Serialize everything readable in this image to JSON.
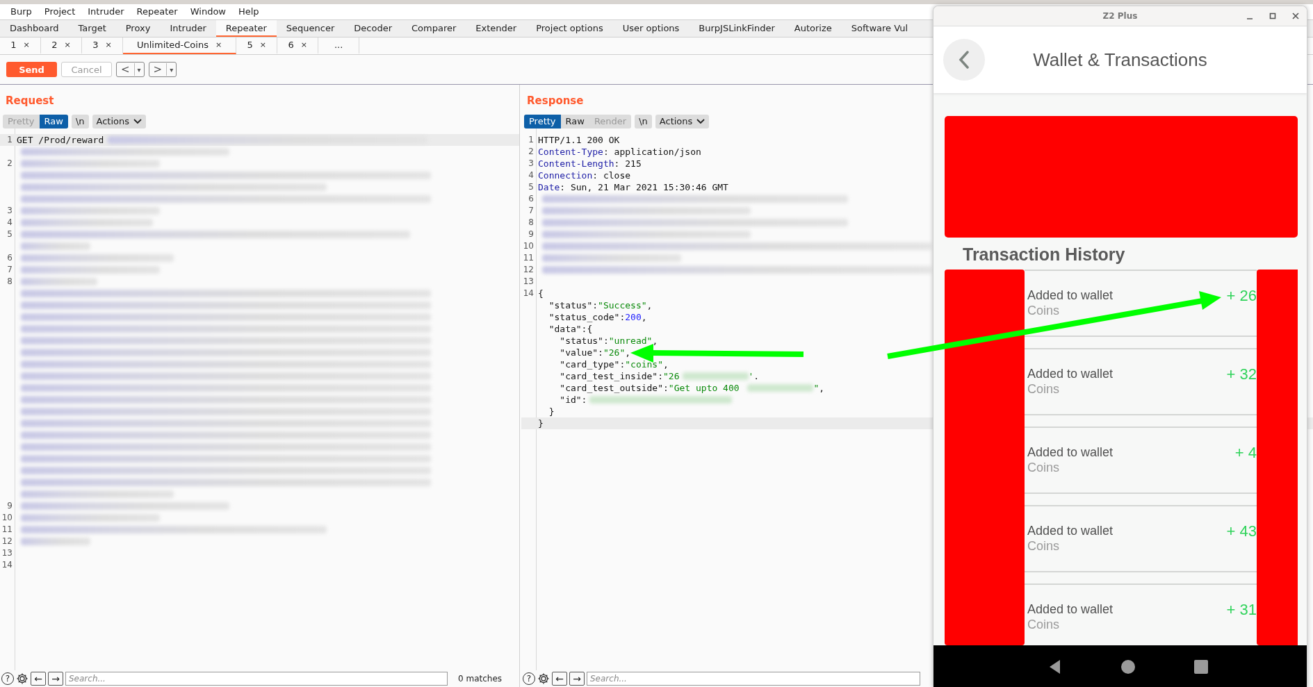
{
  "menu_bar": [
    "Burp",
    "Project",
    "Intruder",
    "Repeater",
    "Window",
    "Help"
  ],
  "main_tabs": [
    {
      "label": "Dashboard",
      "selected": false
    },
    {
      "label": "Target",
      "selected": false
    },
    {
      "label": "Proxy",
      "selected": false
    },
    {
      "label": "Intruder",
      "selected": false
    },
    {
      "label": "Repeater",
      "selected": true
    },
    {
      "label": "Sequencer",
      "selected": false
    },
    {
      "label": "Decoder",
      "selected": false
    },
    {
      "label": "Comparer",
      "selected": false
    },
    {
      "label": "Extender",
      "selected": false
    },
    {
      "label": "Project options",
      "selected": false
    },
    {
      "label": "User options",
      "selected": false
    },
    {
      "label": "BurpJSLinkFinder",
      "selected": false
    },
    {
      "label": "Autorize",
      "selected": false
    },
    {
      "label": "Software Vul",
      "selected": false
    }
  ],
  "repeater_tabs": [
    {
      "label": "1",
      "close": "×",
      "selected": false
    },
    {
      "label": "2",
      "close": "×",
      "selected": false
    },
    {
      "label": "3",
      "close": "×",
      "selected": false
    },
    {
      "label": "Unlimited-Coins",
      "close": "×",
      "selected": true
    },
    {
      "label": "5",
      "close": "×",
      "selected": false
    },
    {
      "label": "6",
      "close": "×",
      "selected": false
    },
    {
      "label": "...",
      "selected": false
    }
  ],
  "toolbar": {
    "send": "Send",
    "cancel": {
      "label": "Cancel",
      "disabled": true
    },
    "back": {
      "arrow": "<",
      "dropdown": "▾"
    },
    "forward": {
      "arrow": ">",
      "dropdown": "▾"
    }
  },
  "request": {
    "title": "Request",
    "view_buttons": [
      {
        "label": "Pretty",
        "selected": false,
        "disabled": true
      },
      {
        "label": "Raw",
        "selected": true,
        "disabled": false
      }
    ],
    "newline": "\\n",
    "actions": "Actions",
    "rows": [
      {
        "number": "1",
        "current": true,
        "tokens": [
          {
            "kind": "plain",
            "text": "GET /Prod/reward"
          },
          {
            "kind": "redacted"
          }
        ]
      },
      {
        "tokens": [
          {
            "kind": "redacted"
          }
        ]
      },
      {
        "number": "2",
        "tokens": [
          {
            "kind": "redacted"
          }
        ]
      },
      {
        "tokens": [
          {
            "kind": "redacted"
          }
        ]
      },
      {
        "tokens": [
          {
            "kind": "redacted"
          }
        ]
      },
      {
        "tokens": [
          {
            "kind": "redacted"
          }
        ]
      },
      {
        "number": "3",
        "tokens": [
          {
            "kind": "redacted"
          }
        ]
      },
      {
        "number": "4",
        "tokens": [
          {
            "kind": "redacted"
          }
        ]
      },
      {
        "number": "5",
        "tokens": [
          {
            "kind": "redacted"
          }
        ]
      },
      {
        "tokens": [
          {
            "kind": "redacted"
          }
        ]
      },
      {
        "number": "6",
        "tokens": [
          {
            "kind": "redacted"
          }
        ]
      },
      {
        "number": "7",
        "tokens": [
          {
            "kind": "redacted"
          }
        ]
      },
      {
        "number": "8",
        "tokens": [
          {
            "kind": "redacted"
          }
        ]
      },
      {
        "tokens": [
          {
            "kind": "redacted"
          }
        ]
      },
      {
        "tokens": [
          {
            "kind": "redacted"
          }
        ]
      },
      {
        "tokens": [
          {
            "kind": "redacted"
          }
        ]
      },
      {
        "tokens": [
          {
            "kind": "redacted"
          }
        ]
      },
      {
        "tokens": [
          {
            "kind": "redacted"
          }
        ]
      },
      {
        "tokens": [
          {
            "kind": "redacted"
          }
        ]
      },
      {
        "tokens": [
          {
            "kind": "redacted"
          }
        ]
      },
      {
        "tokens": [
          {
            "kind": "redacted"
          }
        ]
      },
      {
        "tokens": [
          {
            "kind": "redacted"
          }
        ]
      },
      {
        "tokens": [
          {
            "kind": "redacted"
          }
        ]
      },
      {
        "tokens": [
          {
            "kind": "redacted"
          }
        ]
      },
      {
        "tokens": [
          {
            "kind": "redacted"
          }
        ]
      },
      {
        "tokens": [
          {
            "kind": "redacted"
          }
        ]
      },
      {
        "tokens": [
          {
            "kind": "redacted"
          }
        ]
      },
      {
        "tokens": [
          {
            "kind": "redacted"
          }
        ]
      },
      {
        "tokens": [
          {
            "kind": "redacted"
          }
        ]
      },
      {
        "tokens": [
          {
            "kind": "redacted"
          }
        ]
      },
      {
        "tokens": [
          {
            "kind": "redacted"
          }
        ]
      },
      {
        "number": "9",
        "tokens": [
          {
            "kind": "redacted"
          }
        ]
      },
      {
        "number": "10",
        "tokens": [
          {
            "kind": "redacted"
          }
        ]
      },
      {
        "number": "11",
        "tokens": [
          {
            "kind": "redacted"
          }
        ]
      },
      {
        "number": "12",
        "tokens": [
          {
            "kind": "redacted"
          }
        ]
      },
      {
        "number": "13"
      },
      {
        "number": "14"
      }
    ],
    "search": {
      "help": "?",
      "prev": "←",
      "next": "→",
      "placeholder": "Search...",
      "matches": "0 matches"
    }
  },
  "response": {
    "title": "Response",
    "view_buttons": [
      {
        "label": "Pretty",
        "selected": true,
        "disabled": false
      },
      {
        "label": "Raw",
        "selected": false,
        "disabled": false
      },
      {
        "label": "Render",
        "selected": false,
        "disabled": true
      }
    ],
    "newline": "\\n",
    "actions": "Actions",
    "rows": [
      {
        "number": "1",
        "tokens": [
          {
            "kind": "plain",
            "text": "HTTP/1.1 200 OK"
          }
        ]
      },
      {
        "number": "2",
        "tokens": [
          {
            "kind": "header",
            "text": "Content-Type"
          },
          {
            "kind": "plain",
            "text": ": application/json"
          }
        ]
      },
      {
        "number": "3",
        "tokens": [
          {
            "kind": "header",
            "text": "Content-Length"
          },
          {
            "kind": "plain",
            "text": ": 215"
          }
        ]
      },
      {
        "number": "4",
        "tokens": [
          {
            "kind": "header",
            "text": "Connection"
          },
          {
            "kind": "plain",
            "text": ": close"
          }
        ]
      },
      {
        "number": "5",
        "tokens": [
          {
            "kind": "header",
            "text": "Date"
          },
          {
            "kind": "plain",
            "text": ": Sun, 21 Mar 2021 15:30:46 GMT"
          }
        ]
      },
      {
        "number": "6",
        "tokens": [
          {
            "kind": "redacted"
          }
        ]
      },
      {
        "number": "7",
        "tokens": [
          {
            "kind": "redacted"
          }
        ]
      },
      {
        "number": "8",
        "tokens": [
          {
            "kind": "redacted"
          }
        ]
      },
      {
        "number": "9",
        "tokens": [
          {
            "kind": "redacted"
          }
        ]
      },
      {
        "number": "10",
        "tokens": [
          {
            "kind": "redacted"
          }
        ]
      },
      {
        "number": "11",
        "tokens": [
          {
            "kind": "redacted"
          }
        ]
      },
      {
        "number": "12",
        "tokens": [
          {
            "kind": "redacted"
          }
        ]
      },
      {
        "number": "13"
      },
      {
        "number": "14",
        "tokens": [
          {
            "kind": "plain",
            "text": "{"
          }
        ]
      },
      {
        "tokens": [
          {
            "kind": "plain",
            "text": "  \"status\":"
          },
          {
            "kind": "string",
            "text": "\"Success\""
          },
          {
            "kind": "plain",
            "text": ","
          }
        ]
      },
      {
        "tokens": [
          {
            "kind": "plain",
            "text": "  \"status_code\":"
          },
          {
            "kind": "number",
            "text": "200"
          },
          {
            "kind": "plain",
            "text": ","
          }
        ]
      },
      {
        "tokens": [
          {
            "kind": "plain",
            "text": "  \"data\":{"
          }
        ]
      },
      {
        "tokens": [
          {
            "kind": "plain",
            "text": "    \"status\":"
          },
          {
            "kind": "string",
            "text": "\"unread\""
          },
          {
            "kind": "plain",
            "text": ","
          }
        ]
      },
      {
        "tokens": [
          {
            "kind": "plain",
            "text": "    \"value\":"
          },
          {
            "kind": "string",
            "text": "\"26\""
          },
          {
            "kind": "plain",
            "text": ","
          }
        ]
      },
      {
        "tokens": [
          {
            "kind": "plain",
            "text": "    \"card_type\":"
          },
          {
            "kind": "string",
            "text": "\"coins\""
          },
          {
            "kind": "plain",
            "text": ","
          }
        ]
      },
      {
        "tokens": [
          {
            "kind": "plain",
            "text": "    \"card_test_inside\":"
          },
          {
            "kind": "string",
            "text": "\"26"
          },
          {
            "kind": "redacted"
          },
          {
            "kind": "string",
            "text": "'"
          },
          {
            "kind": "plain",
            "text": "."
          }
        ]
      },
      {
        "tokens": [
          {
            "kind": "plain",
            "text": "    \"card_test_outside\":"
          },
          {
            "kind": "string",
            "text": "\"Get upto 400 "
          },
          {
            "kind": "redacted"
          },
          {
            "kind": "string",
            "text": "\""
          },
          {
            "kind": "plain",
            "text": ","
          }
        ]
      },
      {
        "tokens": [
          {
            "kind": "plain",
            "text": "    \"id\":"
          },
          {
            "kind": "redacted"
          }
        ]
      },
      {
        "tokens": [
          {
            "kind": "plain",
            "text": "  }"
          }
        ]
      },
      {
        "current": true,
        "tokens": [
          {
            "kind": "plain",
            "text": "}"
          }
        ]
      }
    ],
    "search": {
      "help": "?",
      "prev": "←",
      "next": "→",
      "placeholder": "Search..."
    }
  },
  "phone_window": {
    "title": "Z2 Plus",
    "app_title": "Wallet & Transactions",
    "section_title": "Transaction History",
    "transactions": [
      {
        "title": "Added to wallet",
        "subtitle": "Coins",
        "amount": "+ 26"
      },
      {
        "title": "Added to wallet",
        "subtitle": "Coins",
        "amount": "+ 32"
      },
      {
        "title": "Added to wallet",
        "subtitle": "Coins",
        "amount": "+ 4"
      },
      {
        "title": "Added to wallet",
        "subtitle": "Coins",
        "amount": "+ 43"
      },
      {
        "title": "Added to wallet",
        "subtitle": "Coins",
        "amount": "+ 31"
      }
    ]
  }
}
